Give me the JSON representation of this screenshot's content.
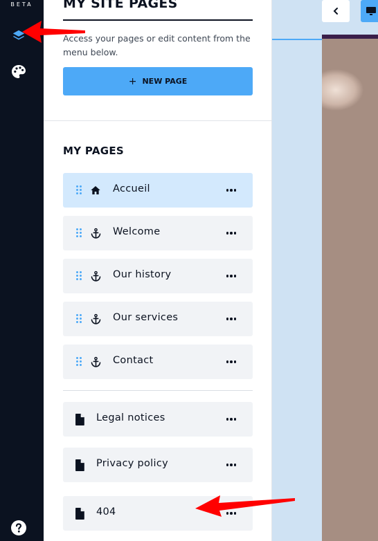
{
  "rail": {
    "beta_label": "BETA",
    "items": [
      {
        "icon": "layers-icon"
      },
      {
        "icon": "palette-icon"
      },
      {
        "icon": "help-icon"
      }
    ]
  },
  "panel": {
    "title": "MY SITE PAGES",
    "description": "Access your pages or edit content from the menu below.",
    "new_page_label": "NEW PAGE",
    "section_title": "MY PAGES",
    "pages": [
      {
        "label": "Accueil",
        "icon": "home-icon",
        "active": true
      },
      {
        "label": "Welcome",
        "icon": "anchor-icon"
      },
      {
        "label": "Our history",
        "icon": "anchor-icon"
      },
      {
        "label": "Our services",
        "icon": "anchor-icon"
      },
      {
        "label": "Contact",
        "icon": "anchor-icon"
      }
    ],
    "system_pages": [
      {
        "label": "Legal notices",
        "icon": "file-icon"
      },
      {
        "label": "Privacy policy",
        "icon": "file-icon"
      },
      {
        "label": "404",
        "icon": "file-icon"
      }
    ]
  },
  "colors": {
    "accent": "#4da9f7",
    "rail_bg": "#0b1220",
    "active_item_bg": "#d3e9fd",
    "item_bg": "#f1f3f6",
    "annotation_arrow": "#ff0000"
  }
}
